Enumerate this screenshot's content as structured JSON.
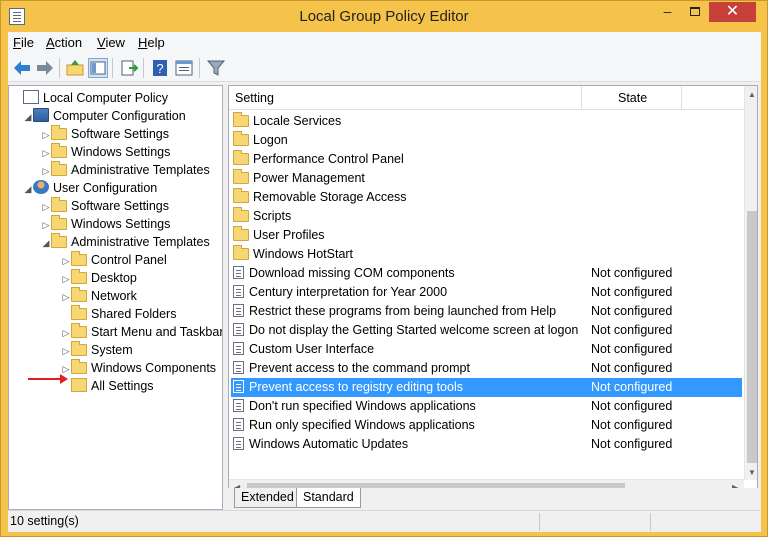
{
  "window": {
    "title": "Local Group Policy Editor",
    "minimize": "–",
    "close": "✕"
  },
  "menu": [
    {
      "underline": "F",
      "rest": "ile"
    },
    {
      "underline": "A",
      "rest": "ction"
    },
    {
      "underline": "V",
      "rest": "iew"
    },
    {
      "underline": "H",
      "rest": "elp"
    }
  ],
  "toolbar": {
    "buttons": [
      "back-icon",
      "forward-icon",
      "up-folder-icon",
      "show-hide-tree-icon",
      "export-list-icon",
      "help-icon",
      "properties-icon",
      "filter-icon"
    ]
  },
  "tree": {
    "items": [
      {
        "label": "Local Computer Policy",
        "expander": "",
        "icon": "policy"
      },
      {
        "label": "Computer Configuration",
        "expander": "◢",
        "icon": "computer"
      },
      {
        "label": "Software Settings",
        "expander": "▷",
        "icon": "folder"
      },
      {
        "label": "Windows Settings",
        "expander": "▷",
        "icon": "folder"
      },
      {
        "label": "Administrative Templates",
        "expander": "▷",
        "icon": "folder"
      },
      {
        "label": "User Configuration",
        "expander": "◢",
        "icon": "user"
      },
      {
        "label": "Software Settings",
        "expander": "▷",
        "icon": "folder"
      },
      {
        "label": "Windows Settings",
        "expander": "▷",
        "icon": "folder"
      },
      {
        "label": "Administrative Templates",
        "expander": "◢",
        "icon": "folder"
      },
      {
        "label": "Control Panel",
        "expander": "▷",
        "icon": "folder"
      },
      {
        "label": "Desktop",
        "expander": "▷",
        "icon": "folder"
      },
      {
        "label": "Network",
        "expander": "▷",
        "icon": "folder"
      },
      {
        "label": "Shared Folders",
        "expander": "",
        "icon": "folder"
      },
      {
        "label": "Start Menu and Taskbar",
        "expander": "▷",
        "icon": "folder"
      },
      {
        "label": "System",
        "expander": "▷",
        "icon": "folder"
      },
      {
        "label": "Windows Components",
        "expander": "▷",
        "icon": "folder"
      },
      {
        "label": "All Settings",
        "expander": "",
        "icon": "allsettings"
      }
    ]
  },
  "list": {
    "columns": {
      "setting": "Setting",
      "state": "State"
    },
    "folders": [
      "Locale Services",
      "Logon",
      "Performance Control Panel",
      "Power Management",
      "Removable Storage Access",
      "Scripts",
      "User Profiles",
      "Windows HotStart"
    ],
    "settings": [
      {
        "name": "Download missing COM components",
        "state": "Not configured"
      },
      {
        "name": "Century interpretation for Year 2000",
        "state": "Not configured"
      },
      {
        "name": "Restrict these programs from being launched from Help",
        "state": "Not configured"
      },
      {
        "name": "Do not display the Getting Started welcome screen at logon",
        "state": "Not configured"
      },
      {
        "name": "Custom User Interface",
        "state": "Not configured"
      },
      {
        "name": "Prevent access to the command prompt",
        "state": "Not configured"
      },
      {
        "name": "Prevent access to registry editing tools",
        "state": "Not configured"
      },
      {
        "name": "Don't run specified Windows applications",
        "state": "Not configured"
      },
      {
        "name": "Run only specified Windows applications",
        "state": "Not configured"
      },
      {
        "name": "Windows Automatic Updates",
        "state": "Not configured"
      }
    ],
    "selected_setting_index": 6
  },
  "tabs": {
    "extended": "Extended",
    "standard": "Standard"
  },
  "status": {
    "text": "10 setting(s)"
  },
  "colors": {
    "selection": "#3399ff",
    "frame": "#f5c24a",
    "close_button": "#c7413a",
    "annotation_arrow": "#e02020"
  }
}
